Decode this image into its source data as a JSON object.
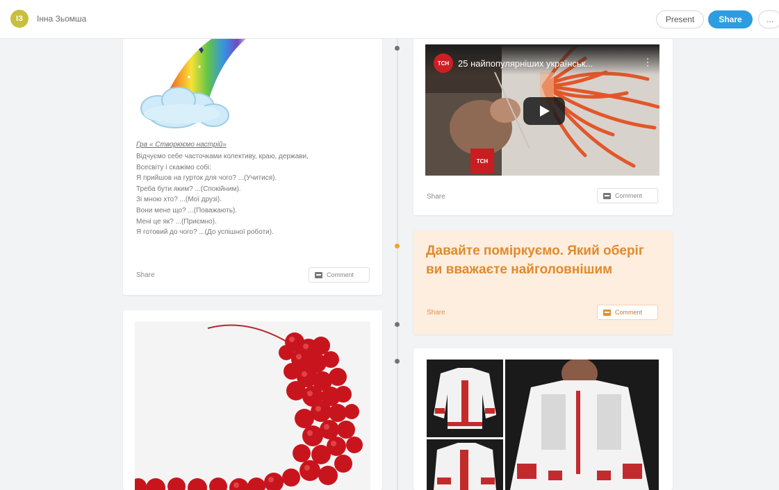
{
  "header": {
    "avatar_initials": "ІЗ",
    "owner_name": "Інна Зьомша",
    "present_label": "Present",
    "share_label": "Share",
    "more_label": "..."
  },
  "colors": {
    "accent": "#2d9de0",
    "orange_card_bg": "#fdeee0",
    "orange_text": "#e08a2d",
    "timeline_dot": "#6f7479",
    "timeline_dot_active": "#f0a623"
  },
  "left_column": {
    "poem_card": {
      "image_icon": "rainbow-cloud-image",
      "title": "Гра « Створюємо настрій»",
      "lines": [
        "Відчуємо себе часточками колективу, краю, держави,",
        "Всесвіту і скажімо собі:",
        "Я прийшов на гурток для чого? ...(Учитися).",
        "Треба бути яким? ...(Спокійним).",
        "Зі мною хто? ...(Мої друзі).",
        "Вони мене що? ...(Поважають).",
        " Мені це як? ...(Приємно).",
        "Я готовий до чого? ...(До успішної роботи)."
      ],
      "share_label": "Share",
      "comment_label": "Comment"
    },
    "image_card": {
      "image_icon": "red-beads-necklace-image"
    }
  },
  "right_column": {
    "video_card": {
      "channel_logo": "ТСН",
      "video_title": "25 найпопулярніших українськ...",
      "badge": "ТСН",
      "share_label": "Share",
      "comment_label": "Comment"
    },
    "question_card": {
      "text": "Давайте поміркуємо. Який оберіг ви вважаєте найголовнішим",
      "share_label": "Share",
      "comment_label": "Comment"
    },
    "image_card": {
      "image_icon": "embroidered-shirts-image"
    }
  }
}
